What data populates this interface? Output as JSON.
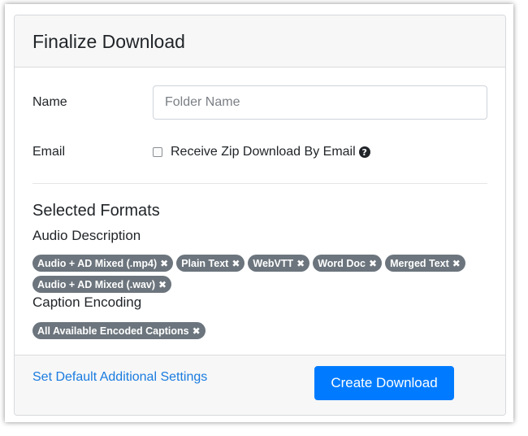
{
  "header": {
    "title": "Finalize Download"
  },
  "form": {
    "name_label": "Name",
    "name_placeholder": "Folder Name",
    "name_value": "",
    "email_label": "Email",
    "email_checkbox_label": "Receive Zip Download By Email",
    "email_checked": false
  },
  "formats": {
    "section_title": "Selected Formats",
    "audio_description": {
      "title": "Audio Description",
      "badges": [
        "Audio + AD Mixed (.mp4)",
        "Plain Text",
        "WebVTT",
        "Word Doc",
        "Merged Text",
        "Audio + AD Mixed (.wav)"
      ]
    },
    "caption_encoding": {
      "title": "Caption Encoding",
      "badges": [
        "All Available Encoded Captions"
      ]
    }
  },
  "footer": {
    "settings_link": "Set Default Additional Settings",
    "create_button": "Create Download"
  },
  "colors": {
    "primary": "#007bff",
    "badge": "#6c757d",
    "link": "#1a7be0"
  },
  "icons": {
    "help": "question-circle-icon",
    "remove": "times-icon"
  }
}
